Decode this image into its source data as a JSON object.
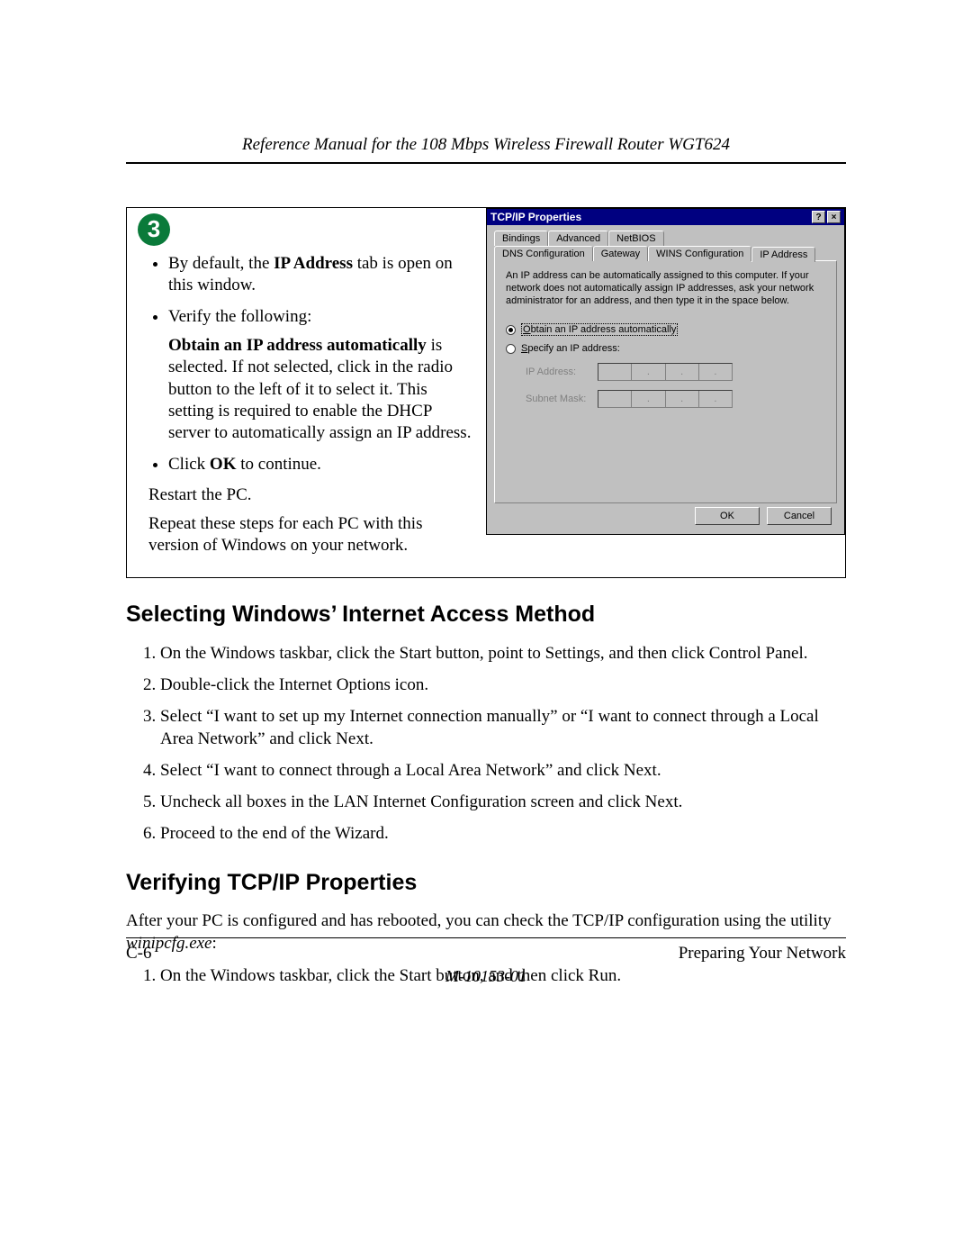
{
  "header": {
    "title": "Reference Manual for the 108 Mbps Wireless Firewall Router WGT624"
  },
  "step": {
    "number": "3",
    "bullet1a": "By default, the ",
    "bullet1b": "IP Address",
    "bullet1c": " tab is open on this window.",
    "bullet2": "Verify the following:",
    "sub_b": "Obtain an IP address automatically",
    "sub_rest": " is selected. If not selected, click in the radio button to the left of it to select it.  This setting is required to enable the DHCP server to automatically assign an IP address.",
    "bullet3a": "Click ",
    "bullet3b": "OK",
    "bullet3c": " to continue.",
    "free1": "Restart the PC.",
    "free2": "Repeat these steps for each PC with this version of Windows on your network."
  },
  "dialog": {
    "title": "TCP/IP Properties",
    "help": "?",
    "close": "×",
    "tabs_row1": [
      "Bindings",
      "Advanced",
      "NetBIOS"
    ],
    "tabs_row2": [
      "DNS Configuration",
      "Gateway",
      "WINS Configuration",
      "IP Address"
    ],
    "info": "An IP address can be automatically assigned to this computer. If your network does not automatically assign IP addresses, ask your network administrator for an address, and then type it in the space below.",
    "radio_auto": "Obtain an IP address automatically",
    "radio_spec": "Specify an IP address:",
    "lbl_ip": "IP Address:",
    "lbl_mask": "Subnet Mask:",
    "dot": ".",
    "ok": "OK",
    "cancel": "Cancel"
  },
  "sec1": {
    "title": "Selecting Windows’ Internet Access Method",
    "items": [
      "On the Windows taskbar, click the Start button, point to Settings, and then click Control Panel.",
      "Double-click the Internet Options icon.",
      "Select “I want to set up my Internet connection manually” or “I want to connect through a Local Area Network” and click Next.",
      "Select “I want to connect through a Local Area Network” and click Next.",
      "Uncheck all boxes in the LAN Internet Configuration screen and click Next.",
      "Proceed to the end of the Wizard."
    ]
  },
  "sec2": {
    "title": "Verifying TCP/IP Properties",
    "intro_a": "After your PC is configured and has rebooted, you can check the TCP/IP configuration using the utility ",
    "intro_b": "winipcfg.exe",
    "intro_c": ":",
    "items": [
      "On the Windows taskbar, click the Start button, and then click Run."
    ]
  },
  "footer": {
    "page": "C-6",
    "section": "Preparing Your Network",
    "doc": "M-10153-01"
  }
}
